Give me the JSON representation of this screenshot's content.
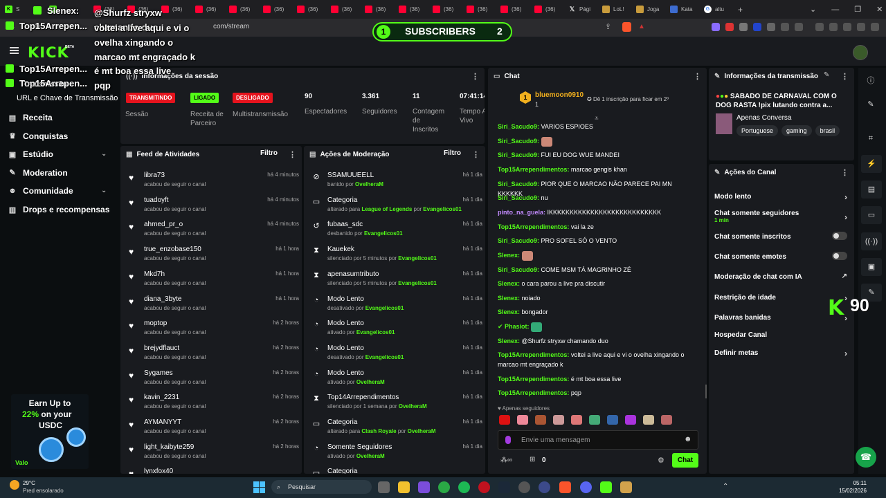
{
  "browser": {
    "tabs": [
      {
        "icon": "kick",
        "label": "S"
      },
      {
        "icon": "x",
        "label": ""
      },
      {
        "icon": "kick",
        "label": ""
      },
      {
        "icon": "yt",
        "label": "(36)"
      },
      {
        "icon": "yt",
        "label": "(36)"
      },
      {
        "icon": "yt",
        "label": "(36)"
      },
      {
        "icon": "yt",
        "label": "(36)"
      },
      {
        "icon": "yt",
        "label": "(36)"
      },
      {
        "icon": "yt",
        "label": "(36)"
      },
      {
        "icon": "yt",
        "label": "(36)"
      },
      {
        "icon": "yt",
        "label": "(36)"
      },
      {
        "icon": "yt",
        "label": "(36)"
      },
      {
        "icon": "yt",
        "label": "(36)"
      },
      {
        "icon": "yt",
        "label": "(36)"
      },
      {
        "icon": "yt",
        "label": "(36)"
      },
      {
        "icon": "yt",
        "label": "(36)"
      },
      {
        "icon": "yt",
        "label": "(36)"
      },
      {
        "icon": "x",
        "label": "Pági"
      },
      {
        "icon": "lol",
        "label": "LoL!"
      },
      {
        "icon": "lol",
        "label": "Joga"
      },
      {
        "icon": "doc",
        "label": "Kata"
      },
      {
        "icon": "g",
        "label": "altu"
      }
    ],
    "new_tab": "+",
    "url": "com/stream"
  },
  "overlay": {
    "subscribers": {
      "left": "1",
      "label": "SUBSCRIBERS",
      "right": "2"
    },
    "chat": [
      {
        "user": "Slenex:",
        "msg": "@Shurfz stryxw chamando duo"
      },
      {
        "user": "Top15Arrepen...",
        "msg": "voltei a live aqui e vi o ovelha xingando o marcao mt engraçado k"
      },
      {
        "user": "Top15Arrepen...",
        "msg": "é mt boa essa live"
      },
      {
        "user": "Top15Arrepen...",
        "msg": "pqp"
      }
    ],
    "transmissao_fragment": "Transmissão",
    "kick_count": "90"
  },
  "header": {
    "logo": "KICK",
    "beta": "BETA"
  },
  "sidebar": {
    "url_item": "URL e Chave de Transmissão",
    "items": [
      {
        "label": "Receita",
        "icon": "receipt-icon",
        "glyph": "▤",
        "chevron": false
      },
      {
        "label": "Conquistas",
        "icon": "trophy-icon",
        "glyph": "♛",
        "chevron": false
      },
      {
        "label": "Estúdio",
        "icon": "studio-icon",
        "glyph": "▣",
        "chevron": true
      },
      {
        "label": "Moderation",
        "icon": "wrench-icon",
        "glyph": "✎",
        "chevron": false
      },
      {
        "label": "Comunidade",
        "icon": "community-icon",
        "glyph": "☻",
        "chevron": true
      },
      {
        "label": "Drops e recompensas",
        "icon": "drops-icon",
        "glyph": "▥",
        "chevron": false
      }
    ],
    "promo": {
      "line1": "Earn Up to",
      "highlight": "22%",
      "line2": "on your",
      "line3": "USDC",
      "brand": "Valo"
    }
  },
  "session": {
    "title": "Informações da sessão",
    "status": [
      {
        "badge": "TRANSMITINDO",
        "label": "Sessão",
        "color": "#e5131d"
      },
      {
        "badge": "LIGADO",
        "label": "Receita de Parceiro",
        "color": "#53fc18"
      },
      {
        "badge": "DESLIGADO",
        "label": "Multistransmissão",
        "color": "#e5131d"
      }
    ],
    "stats": [
      {
        "value": "90",
        "label": "Espectadores"
      },
      {
        "value": "3.361",
        "label": "Seguidores"
      },
      {
        "value": "11",
        "label": "Contagem de Inscritos"
      },
      {
        "value": "07:41:14",
        "label": "Tempo Ao Vivo"
      }
    ]
  },
  "feed": {
    "title": "Feed de Atividades",
    "filter": "Filtro",
    "rows": [
      {
        "name": "libra73",
        "sub": "acabou de seguir o canal",
        "time": "há 4 minutos"
      },
      {
        "name": "tuadoyft",
        "sub": "acabou de seguir o canal",
        "time": "há 4 minutos"
      },
      {
        "name": "ahmed_pr_o",
        "sub": "acabou de seguir o canal",
        "time": "há 4 minutos"
      },
      {
        "name": "true_enzobase150",
        "sub": "acabou de seguir o canal",
        "time": "há 1 hora"
      },
      {
        "name": "Mkd7h",
        "sub": "acabou de seguir o canal",
        "time": "há 1 hora"
      },
      {
        "name": "diana_3byte",
        "sub": "acabou de seguir o canal",
        "time": "há 1 hora"
      },
      {
        "name": "moptop",
        "sub": "acabou de seguir o canal",
        "time": "há 2 horas"
      },
      {
        "name": "brejydflauct",
        "sub": "acabou de seguir o canal",
        "time": "há 2 horas"
      },
      {
        "name": "Sygames",
        "sub": "acabou de seguir o canal",
        "time": "há 2 horas"
      },
      {
        "name": "kavin_2231",
        "sub": "acabou de seguir o canal",
        "time": "há 2 horas"
      },
      {
        "name": "AYMANYYT",
        "sub": "acabou de seguir o canal",
        "time": "há 2 horas"
      },
      {
        "name": "light_kaibyte259",
        "sub": "acabou de seguir o canal",
        "time": "há 2 horas"
      },
      {
        "name": "lynxfox40",
        "sub": "",
        "time": ""
      }
    ]
  },
  "moderation": {
    "title": "Ações de Moderação",
    "filter": "Filtro",
    "rows": [
      {
        "icon": "⊘",
        "name": "SSAMUUEELL",
        "pre": "banido por ",
        "mid": "",
        "by": "OvelheraM",
        "time": "há 1 dia"
      },
      {
        "icon": "▭",
        "name": "Categoria",
        "pre": "alterado para ",
        "mid": "League of Legends",
        "by": "Evangelicos01",
        "time": "há 1 dia"
      },
      {
        "icon": "↺",
        "name": "fubaas_sdc",
        "pre": "desbanido por ",
        "mid": "",
        "by": "Evangelicos01",
        "time": "há 1 dia"
      },
      {
        "icon": "⧗",
        "name": "Kauekek",
        "pre": "silenciado por 5 minutos por ",
        "mid": "",
        "by": "Evangelicos01",
        "time": "há 1 dia"
      },
      {
        "icon": "⧗",
        "name": "apenasumtributo",
        "pre": "silenciado por 5 minutos por ",
        "mid": "",
        "by": "Evangelicos01",
        "time": "há 1 dia"
      },
      {
        "icon": "◔",
        "name": "Modo Lento",
        "pre": "desativado por ",
        "mid": "",
        "by": "Evangelicos01",
        "time": "há 1 dia"
      },
      {
        "icon": "◔",
        "name": "Modo Lento",
        "pre": "ativado por ",
        "mid": "",
        "by": "Evangelicos01",
        "time": "há 1 dia"
      },
      {
        "icon": "◔",
        "name": "Modo Lento",
        "pre": "desativado por ",
        "mid": "",
        "by": "Evangelicos01",
        "time": "há 1 dia"
      },
      {
        "icon": "◔",
        "name": "Modo Lento",
        "pre": "ativado por ",
        "mid": "",
        "by": "OvelheraM",
        "time": "há 1 dia"
      },
      {
        "icon": "⧗",
        "name": "Top14Arrependimentos",
        "pre": "silenciado por 1 semana por ",
        "mid": "",
        "by": "OvelheraM",
        "time": "há 1 dia"
      },
      {
        "icon": "▭",
        "name": "Categoria",
        "pre": "alterado para ",
        "mid": "Clash Royale",
        "by": "OvelheraM",
        "time": "há 1 dia"
      },
      {
        "icon": "◔",
        "name": "Somente Seguidores",
        "pre": "ativado por ",
        "mid": "",
        "by": "OvelheraM",
        "time": "há 1 dia"
      },
      {
        "icon": "▭",
        "name": "Categoria",
        "pre": "",
        "mid": "",
        "by": "",
        "time": ""
      }
    ]
  },
  "chat": {
    "title": "Chat",
    "pinned": {
      "user": "bluemoon0910",
      "count": "1",
      "info": "Dê 1 inscrição para ficar em 2º"
    },
    "messages": [
      {
        "user": "Siri_Sacudo9:",
        "text": "VARIOS ESPIOES",
        "color": "#53fc18",
        "emote": false
      },
      {
        "user": "Siri_Sacudo9:",
        "text": "",
        "color": "#53fc18",
        "emote": true
      },
      {
        "user": "Siri_Sacudo9:",
        "text": "FUI EU DOG WUE MANDEI",
        "color": "#53fc18",
        "emote": false
      },
      {
        "user": "Top15Arrependimentos:",
        "text": "marcao gengis khan",
        "color": "#53fc18",
        "emote": false
      },
      {
        "user": "Siri_Sacudo9:",
        "text": "PIOR QUE O MARCAO NÃO PARECE PAI MN KKKKKK",
        "color": "#53fc18",
        "emote": false
      },
      {
        "user": "Siri_Sacudo9:",
        "text": "nu",
        "color": "#53fc18",
        "emote": false
      },
      {
        "user": "pinto_na_guela:",
        "text": "IKKKKKKKKKKKKKKKKKKKKKKKKKKK",
        "color": "#c38bff",
        "emote": false
      },
      {
        "user": "Top15Arrependimentos:",
        "text": "vai la ze",
        "color": "#53fc18",
        "emote": false
      },
      {
        "user": "Siri_Sacudo9:",
        "text": "PRO SOFEL SÓ O VENTO",
        "color": "#53fc18",
        "emote": false
      },
      {
        "user": "Slenex:",
        "text": "",
        "color": "#53fc18",
        "emote": true
      },
      {
        "user": "Siri_Sacudo9:",
        "text": "COME MSM TÁ MAGRINHO ZÉ",
        "color": "#53fc18",
        "emote": false
      },
      {
        "user": "Slenex:",
        "text": "o cara parou a live pra discutir",
        "color": "#53fc18",
        "emote": false
      },
      {
        "user": "Slenex:",
        "text": "noiado",
        "color": "#53fc18",
        "emote": false
      },
      {
        "user": "Slenex:",
        "text": "bongador",
        "color": "#53fc18",
        "emote": false
      },
      {
        "user": "Phasiot:",
        "text": "",
        "color": "#53fc18",
        "emote": true
      },
      {
        "user": "Slenex:",
        "text": "@Shurfz stryxw chamando duo",
        "color": "#53fc18",
        "emote": false
      },
      {
        "user": "Top15Arrependimentos:",
        "text": "voltei a live aqui e vi o ovelha xingando o marcao mt engraçado k",
        "color": "#53fc18",
        "emote": false
      },
      {
        "user": "Top15Arrependimentos:",
        "text": "é mt boa essa live",
        "color": "#53fc18",
        "emote": false
      },
      {
        "user": "Top15Arrependimentos:",
        "text": "pqp",
        "color": "#53fc18",
        "emote": false
      }
    ],
    "followers_only": "Apenas seguidores",
    "placeholder": "Envie uma mensagem",
    "points": "0",
    "send": "Chat"
  },
  "stream_info": {
    "title": "Informações da transmissão",
    "stream_title": "SABADO DE CARNAVAL COM O DOG RASTA !pix lutando contra a...",
    "category": "Apenas Conversa",
    "tags": [
      "Portuguese",
      "gaming",
      "brasil"
    ]
  },
  "channel_actions": {
    "title": "Ações do Canal",
    "items": [
      {
        "label": "Modo lento",
        "sub": "",
        "control": "arrow"
      },
      {
        "label": "Chat somente seguidores",
        "sub": "1 min",
        "control": "arrow"
      },
      {
        "label": "Chat somente inscritos",
        "sub": "",
        "control": "toggle"
      },
      {
        "label": "Chat somente emotes",
        "sub": "",
        "control": "toggle"
      },
      {
        "label": "Moderação de chat com IA",
        "sub": "",
        "control": "external"
      },
      {
        "label": "Restrição de idade",
        "sub": "",
        "control": "arrow"
      },
      {
        "label": "Palavras banidas",
        "sub": "",
        "control": "arrow"
      },
      {
        "label": "Hospedar Canal",
        "sub": "",
        "control": "none"
      },
      {
        "label": "Definir metas",
        "sub": "",
        "control": "arrow"
      }
    ]
  },
  "taskbar": {
    "weather": {
      "temp": "29°C",
      "desc": "Pred ensolarado"
    },
    "search": "Pesquisar",
    "time": "05:11",
    "date": "15/02/2026"
  },
  "colors": {
    "accent": "#53fc18",
    "danger": "#e5131d",
    "panel": "#191b1f",
    "bg": "#0b0e10"
  }
}
